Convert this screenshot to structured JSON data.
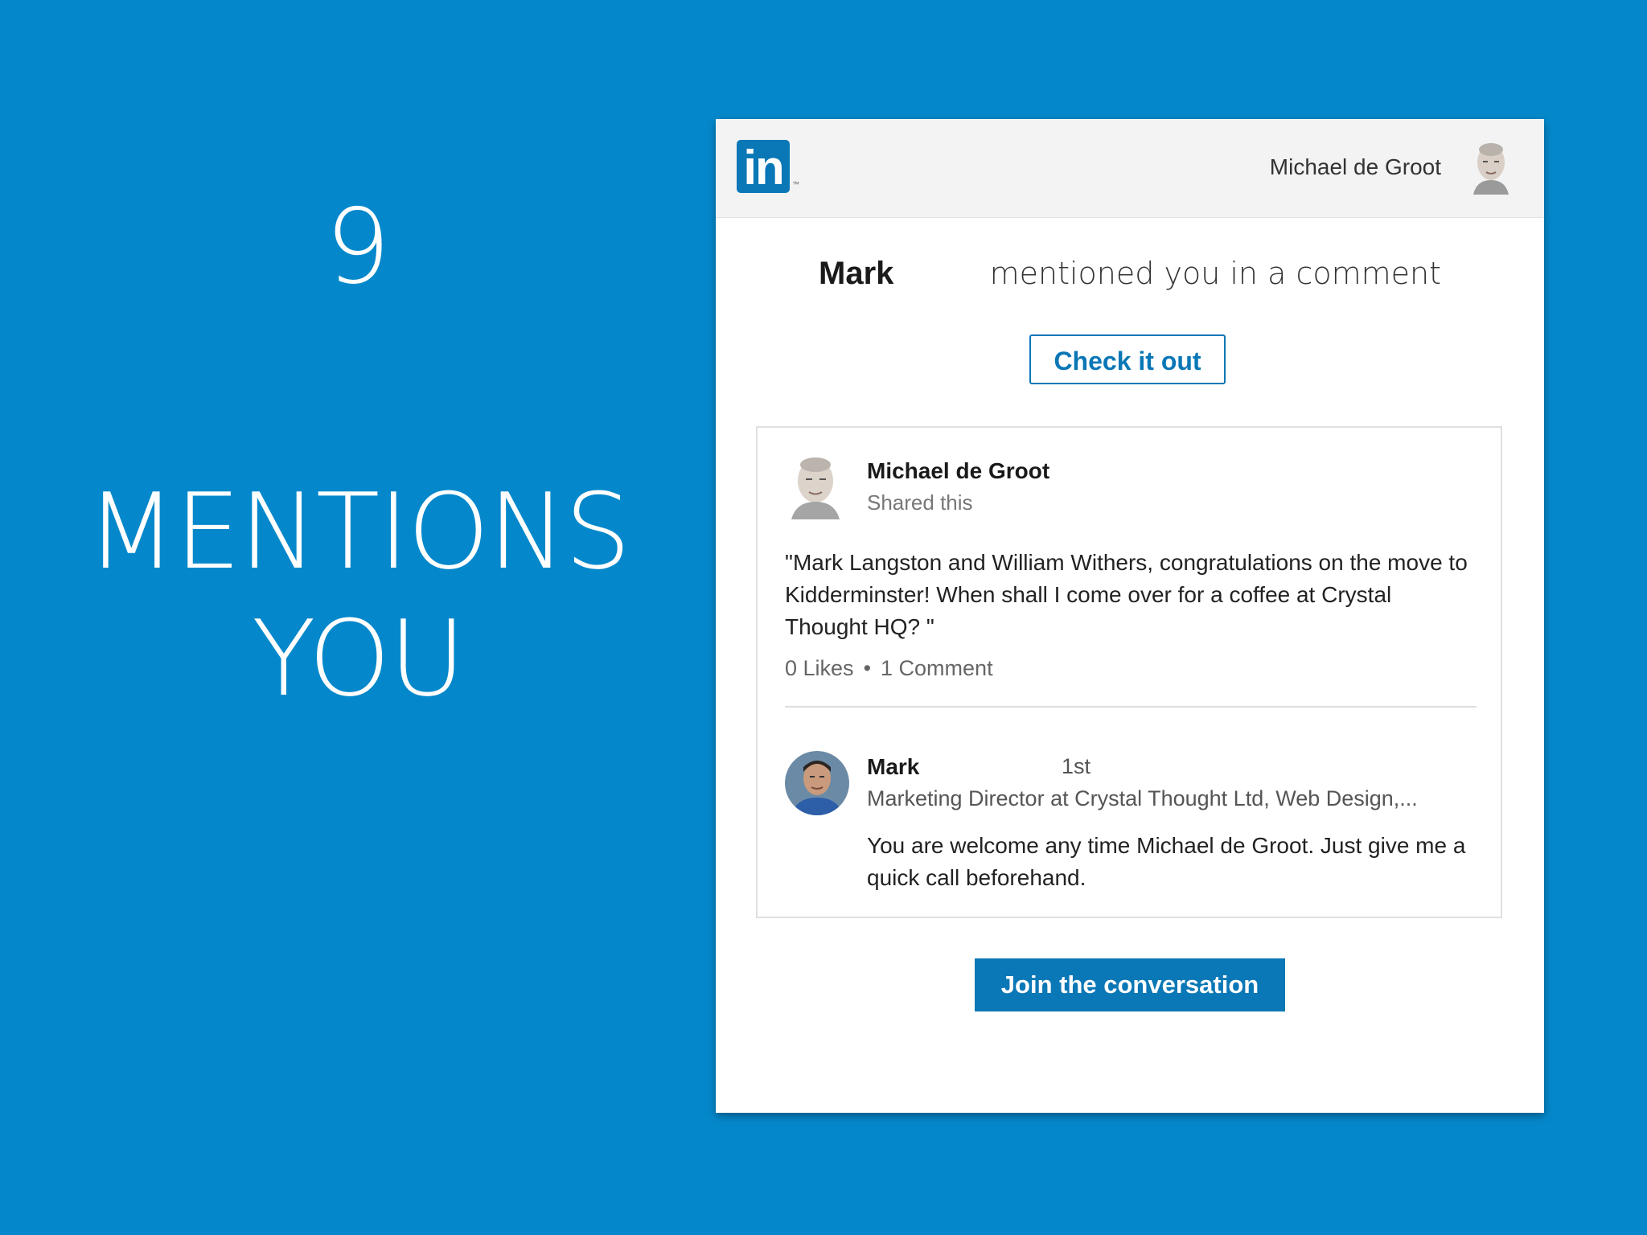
{
  "slide": {
    "number": "9",
    "title_line1": "MENTIONS",
    "title_line2": "YOU"
  },
  "email": {
    "header": {
      "logo_text": "in",
      "logo_tm": "™",
      "user_name": "Michael de Groot"
    },
    "mention": {
      "name": "Mark",
      "text": "mentioned you in a comment"
    },
    "check_button": "Check it out",
    "post": {
      "author": "Michael de Groot",
      "subtitle": "Shared this",
      "text": "\"Mark Langston and William Withers, congratulations on the move to Kidderminster! When shall I come over for a coffee at Crystal Thought HQ? \"",
      "likes": "0 Likes",
      "separator": "•",
      "comments": "1 Comment"
    },
    "comment": {
      "name": "Mark",
      "degree": "1st",
      "headline": "Marketing Director at Crystal Thought Ltd, Web Design,...",
      "text": "You are welcome any time Michael de Groot. Just give me a quick call beforehand."
    },
    "join_button": "Join the conversation"
  },
  "colors": {
    "background": "#0588cb",
    "linkedin_blue": "#0a77b6"
  }
}
